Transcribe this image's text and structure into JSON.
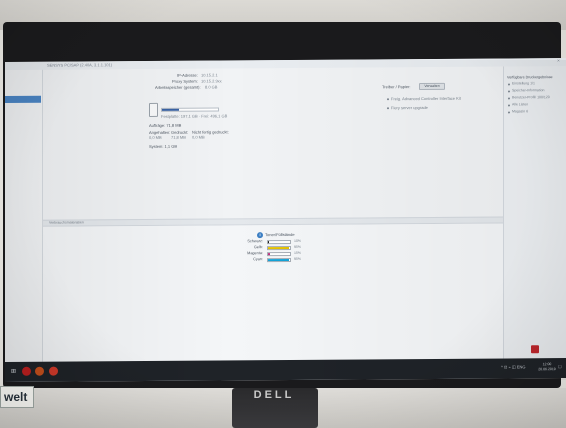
{
  "window": {
    "title": "SENSYS PC/SAP (2.40A, 3.1.1.101)",
    "close_glyph": "×"
  },
  "system_info": {
    "ip_address_label": "IP-Adresse:",
    "ip_address_value": "10.15.2.1",
    "proxy_label": "Proxy System:",
    "proxy_value": "10.15.2.9xx",
    "free_memory_label": "Arbeitsspeicher (gesamt):",
    "free_memory_value": "8.0 GB",
    "hdd_text": "Festplatte: 197,1 GB · Frei: 496,1 GB",
    "hdd_fraction": 0.3,
    "aufträge_label": "Aufträge: 71,8 MB",
    "gespeichert_header": "Angehalten:",
    "gedruckt_header": "Gedruckt:",
    "nicht_header": "Nicht fertig gedruckt:",
    "val1": "0,0 MB",
    "val2": "71,8 MB",
    "val3": "0,0 MB",
    "system_label": "System: 1,1 GB"
  },
  "drivers": {
    "title": "Treiber / Papier:",
    "button_label": "Verwalten",
    "items": [
      "Freig. Advanced Controller Interface Kit",
      "Fiery server upgrade"
    ]
  },
  "right_panel": {
    "title": "Verfügbare Druckergebnisse",
    "items": [
      "Einstellung 1/1",
      "Speicher-Information",
      "Benutzer-Profil/ 100/120",
      "Alle Listen",
      "Magazin 6"
    ]
  },
  "lower_section": {
    "section_title": "Verbrauchsmaterialien",
    "toner_title": "Toner/Füllstände",
    "toners": [
      {
        "name": "Schwarz:",
        "percent": 0.05,
        "percent_label": "10%",
        "color": "#1c1c1c"
      },
      {
        "name": "Gelb:",
        "percent": 0.95,
        "percent_label": "95%",
        "color": "#e5c200"
      },
      {
        "name": "Magenta:",
        "percent": 0.1,
        "percent_label": "15%",
        "color": "#c0307f"
      },
      {
        "name": "Cyan:",
        "percent": 0.95,
        "percent_label": "95%",
        "color": "#13a3d8"
      }
    ]
  },
  "taskbar": {
    "start_glyph": "⊞",
    "tray_glyphs": "^ ⊡ ⌁ ◫ ENG",
    "time": "12:00",
    "date": "20.06.2019",
    "notify_glyph": "☐",
    "app_colors": [
      "#c02020",
      "#c8501c",
      "#d23a2a"
    ]
  },
  "brand": {
    "monitor_logo": "DELL",
    "store_sign": "welt"
  },
  "colors": {
    "selection": "#4b86c6",
    "bezel": "#1a1a1c"
  }
}
